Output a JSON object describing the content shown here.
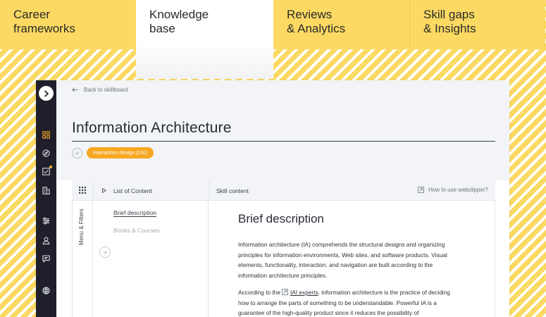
{
  "top_tabs": [
    {
      "label": "Career\nframeworks",
      "active": false
    },
    {
      "label": "Knowledge\nbase",
      "active": true
    },
    {
      "label": "Reviews\n& Analytics",
      "active": false
    },
    {
      "label": "Skill gaps\n& Insights",
      "active": false
    }
  ],
  "sidebar": {
    "icons": [
      "dashboard-icon",
      "compass-icon",
      "checklist-icon",
      "building-icon",
      "sliders-icon",
      "user-icon",
      "chat-icon",
      "globe-icon"
    ]
  },
  "header": {
    "back_label": "Back to skillboard",
    "title": "Information Architecture",
    "tag": "Interaction design (UX)"
  },
  "columns": {
    "toc_title": "List of Content",
    "content_title": "Skill content",
    "help_label": "How to use webclipper?"
  },
  "filters_label": "Menu & Filters",
  "toc": {
    "items": [
      "Brief description",
      "Books & Courses"
    ]
  },
  "content": {
    "heading": "Brief description",
    "para1": "Information architecture (IA) comprehends the structural designs and organizing principles for information environments, Web sites, and software products. Visual elements, functionality, interaction, and navigation are built according to the information architecture principles.",
    "para2_before": "According to the",
    "para2_link": "IAI experts",
    "para2_after": ", information architecture is the practice of deciding how to arrange the parts of something to be understandable. Powerful IA is a guarantee of the high-quality product since it reduces the possibility of"
  },
  "colors": {
    "accent": "#f7a823",
    "background_yellow": "#fbd962",
    "rail": "#1f1f2b"
  }
}
